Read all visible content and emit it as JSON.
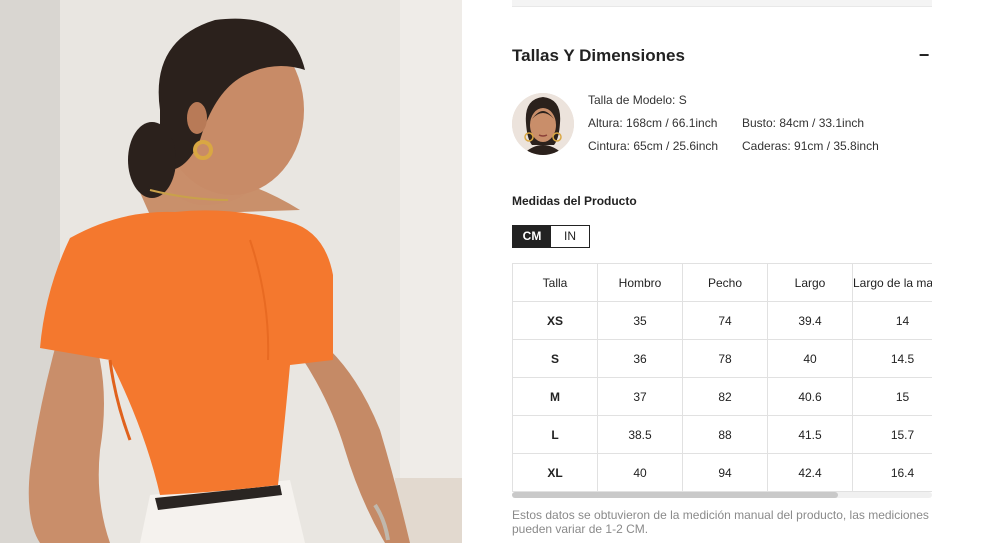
{
  "size_guide": {
    "title": "Tallas Y Dimensiones",
    "collapse_icon": "−",
    "model": {
      "size_label": "Talla de Modelo: S",
      "height": "Altura: 168cm / 66.1inch",
      "bust": "Busto: 84cm / 33.1inch",
      "waist": "Cintura: 65cm / 25.6inch",
      "hips": "Caderas: 91cm / 35.8inch"
    },
    "measures_title": "Medidas del Producto",
    "units": {
      "cm": "CM",
      "in": "IN",
      "selected": "CM"
    },
    "table": {
      "headers": [
        "Talla",
        "Hombro",
        "Pecho",
        "Largo",
        "Largo de la manga"
      ],
      "rows": [
        [
          "XS",
          "35",
          "74",
          "39.4",
          "14"
        ],
        [
          "S",
          "36",
          "78",
          "40",
          "14.5"
        ],
        [
          "M",
          "37",
          "82",
          "40.6",
          "15"
        ],
        [
          "L",
          "38.5",
          "88",
          "41.5",
          "15.7"
        ],
        [
          "XL",
          "40",
          "94",
          "42.4",
          "16.4"
        ]
      ]
    },
    "note": "Estos datos se obtuvieron de la medición manual del producto, las mediciones pueden variar de 1-2 CM."
  },
  "colors": {
    "accent_dark": "#222222",
    "shirt_orange": "#f4782e",
    "note_gray": "#8a8a8a"
  }
}
